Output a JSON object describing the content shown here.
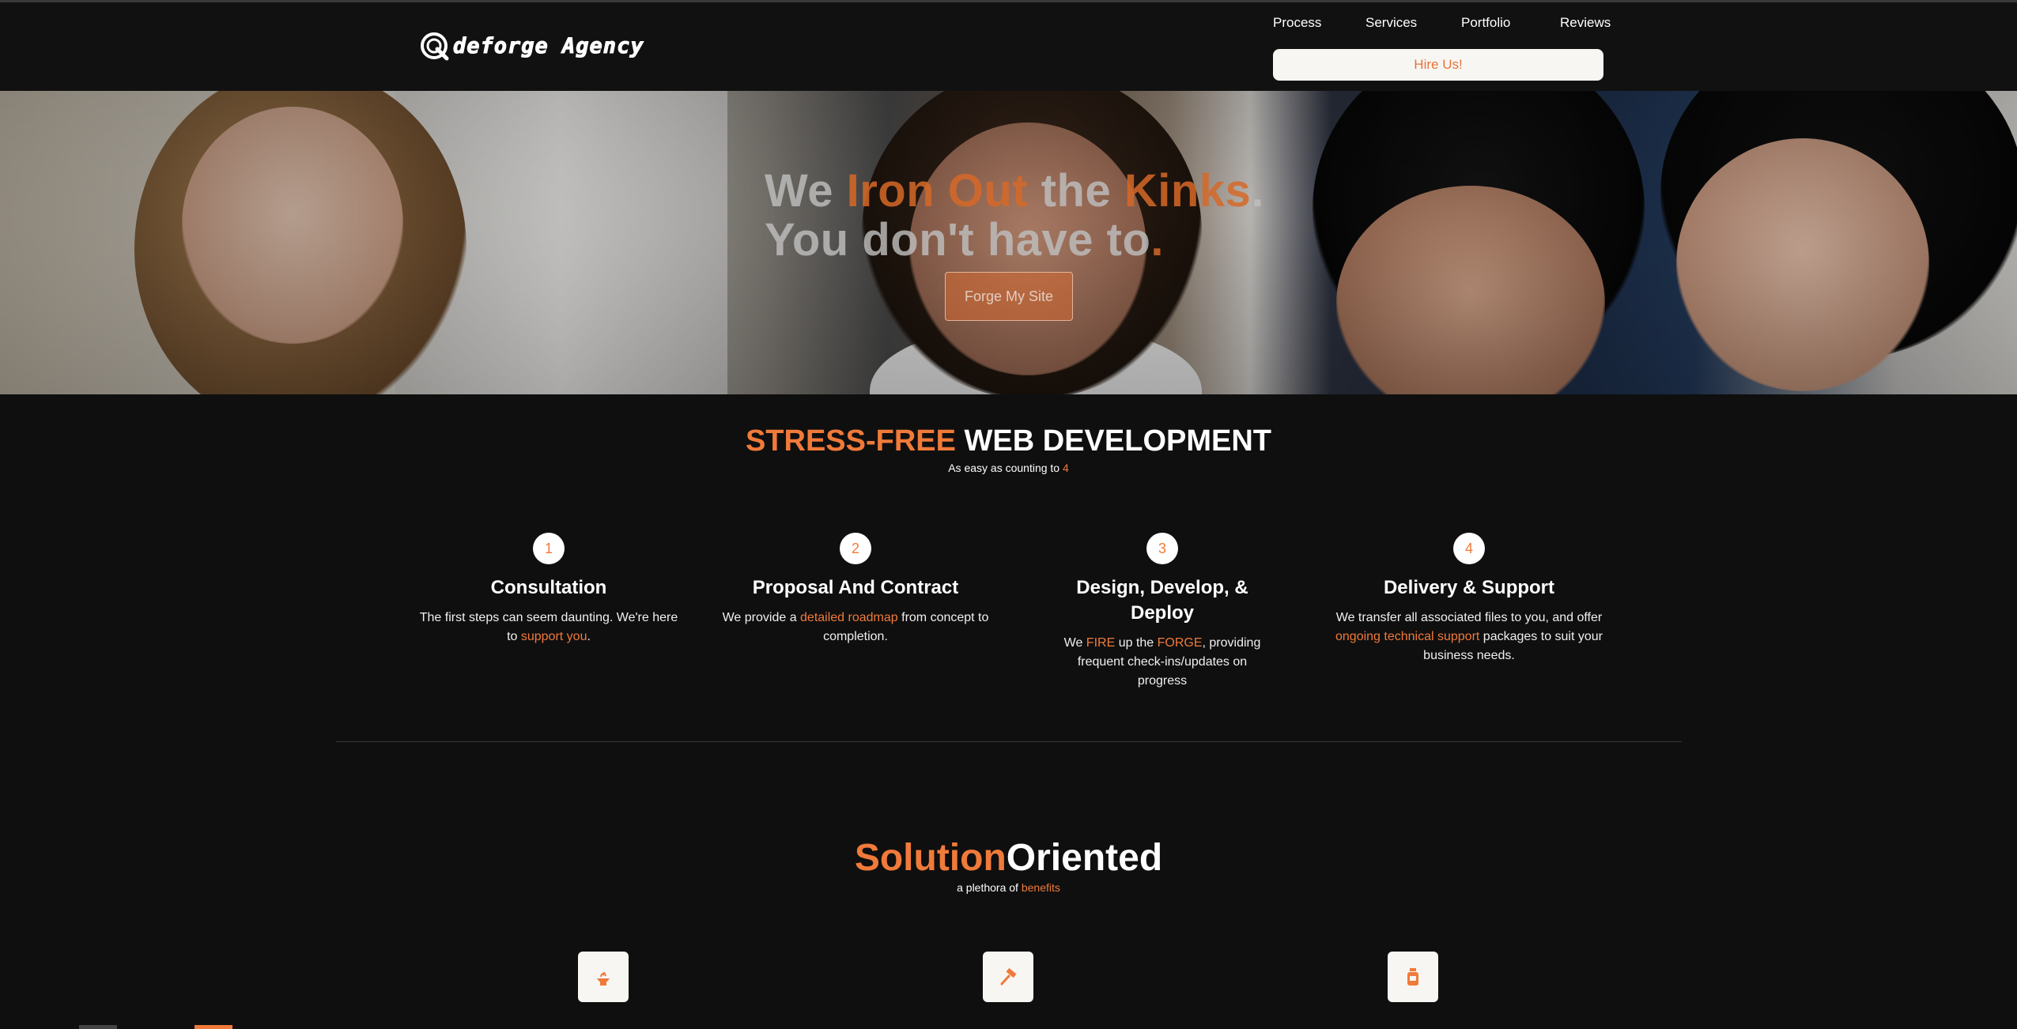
{
  "header": {
    "logo_text": "deforge Agency",
    "nav": [
      "Process",
      "Services",
      "Portfolio",
      "Reviews"
    ],
    "cta": "Hire Us!"
  },
  "hero": {
    "line1_a": "We ",
    "line1_b": "Iron Out",
    "line1_c": " the ",
    "line1_d": "Kinks",
    "line1_e": ".",
    "line2_a": "You don't have to",
    "line2_b": ".",
    "button": "Forge My Site"
  },
  "process": {
    "title_accent": "STRESS-FREE",
    "title_rest": " WEB DEVELOPMENT",
    "subtitle": "As easy as counting to ",
    "subtitle_accent": "4",
    "steps": [
      {
        "num": "1",
        "title": "Consultation",
        "desc_a": "The first steps can seem daunting. We're here to ",
        "desc_b": "support you",
        "desc_c": "."
      },
      {
        "num": "2",
        "title": "Proposal And Contract",
        "desc_a": "We provide a ",
        "desc_b": "detailed roadmap",
        "desc_c": " from concept to completion."
      },
      {
        "num": "3",
        "title": "Design, Develop, & Deploy",
        "desc_a": "We ",
        "desc_b": "FIRE",
        "desc_c": " up the ",
        "desc_d": "FORGE",
        "desc_e": ", providing frequent check-ins/updates on progress"
      },
      {
        "num": "4",
        "title": "Delivery & Support",
        "desc_a": "We transfer all associated files to you, and offer ",
        "desc_b": "ongoing technical support",
        "desc_c": " packages to suit your business needs."
      }
    ]
  },
  "solutions": {
    "title_accent": "Solution",
    "title_rest": "Oriented",
    "subtitle": "a plethora of ",
    "subtitle_accent": "benefits",
    "icons": [
      "forge-icon",
      "hammer-icon",
      "jar-icon"
    ]
  },
  "colors": {
    "accent": "#f07a3a",
    "background": "#0f0f0f",
    "header": "#111111"
  }
}
